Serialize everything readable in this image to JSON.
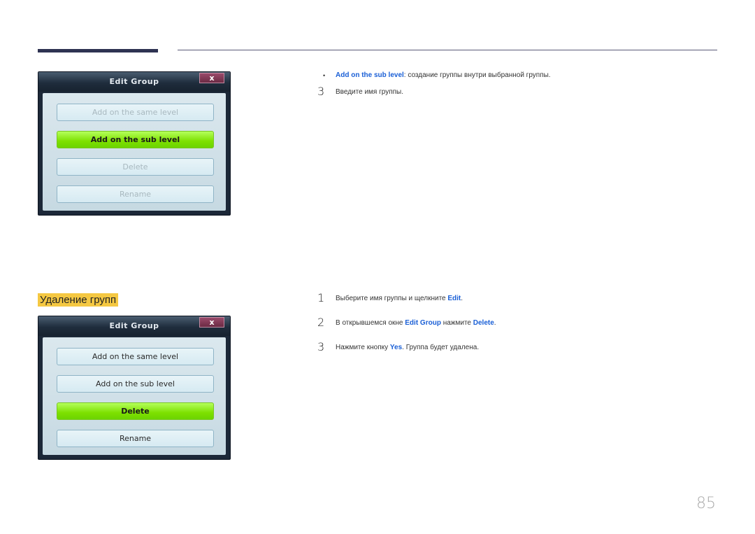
{
  "dialog_top": {
    "title": "Edit Group",
    "close": "x",
    "buttons": [
      {
        "label": "Add on the same level",
        "state": "disabled"
      },
      {
        "label": "Add on the sub level",
        "state": "active"
      },
      {
        "label": "Delete",
        "state": "disabled"
      },
      {
        "label": "Rename",
        "state": "disabled"
      }
    ]
  },
  "dialog_bottom": {
    "title": "Edit Group",
    "close": "x",
    "buttons": [
      {
        "label": "Add on the same level",
        "state": "normal"
      },
      {
        "label": "Add on the sub level",
        "state": "normal"
      },
      {
        "label": "Delete",
        "state": "active"
      },
      {
        "label": "Rename",
        "state": "normal"
      }
    ]
  },
  "top_instructions": {
    "bullet": "•",
    "bullet_hl": "Add on the sub level",
    "bullet_text": ": создание группы внутри выбранной группы.",
    "step3_num": "3",
    "step3_text": "Введите имя группы."
  },
  "section_title": "Удаление групп",
  "delete_steps": [
    {
      "num": "1",
      "pre": "Выберите имя группы и щелкните ",
      "hl1": "Edit",
      "mid": ".",
      "hl2": "",
      "post": ""
    },
    {
      "num": "2",
      "pre": "В открывшемся окне ",
      "hl1": "Edit Group",
      "mid": " нажмите ",
      "hl2": "Delete",
      "post": "."
    },
    {
      "num": "3",
      "pre": "Нажмите кнопку ",
      "hl1": "Yes",
      "mid": ". Группа будет удалена.",
      "hl2": "",
      "post": ""
    }
  ],
  "page_number": "85",
  "colors": {
    "accent": "#1a5fd6",
    "active_button": "#7de000",
    "highlight": "#f5c842"
  }
}
